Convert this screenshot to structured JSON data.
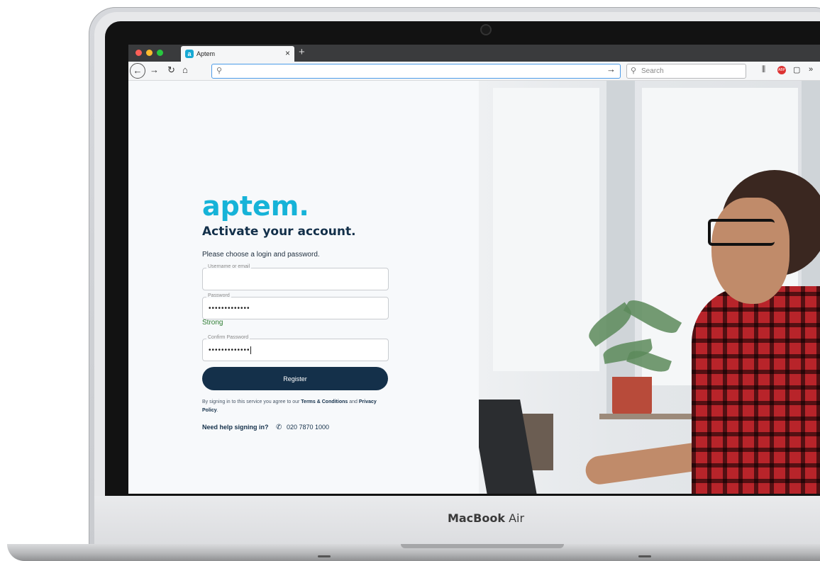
{
  "device": {
    "brand_bold": "MacBook",
    "brand_light": "Air"
  },
  "browser": {
    "tab_title": "Aptem",
    "tab_icon_letter": "a",
    "tab_close": "×",
    "new_tab": "+",
    "url": "",
    "search_placeholder": "Search",
    "icons": [
      "back-icon",
      "forward-icon",
      "reload-icon",
      "home-icon",
      "search-icon",
      "go-arrow-icon",
      "library-icon",
      "adblock-icon",
      "sidebar-icon",
      "overflow-icon"
    ]
  },
  "login": {
    "logo": "aptem.",
    "heading": "Activate your account.",
    "intro": "Please choose a login and password.",
    "username_label": "Username or email",
    "username_value": "",
    "password_label": "Password",
    "password_value": "•••••••••••••",
    "strength": "Strong",
    "confirm_label": "Confirm Password",
    "confirm_value": "•••••••••••••",
    "register_label": "Register",
    "terms_prefix": "By signing in to this service you agree to our ",
    "terms_link": "Terms & Conditions",
    "terms_and": " and ",
    "privacy_link": "Privacy Policy",
    "terms_suffix": ".",
    "help_title": "Need help signing in?",
    "help_phone": "020 7870 1000"
  },
  "colors": {
    "brand_cyan": "#16b3d8",
    "navy": "#14304a",
    "strength_green": "#2e7d32"
  }
}
